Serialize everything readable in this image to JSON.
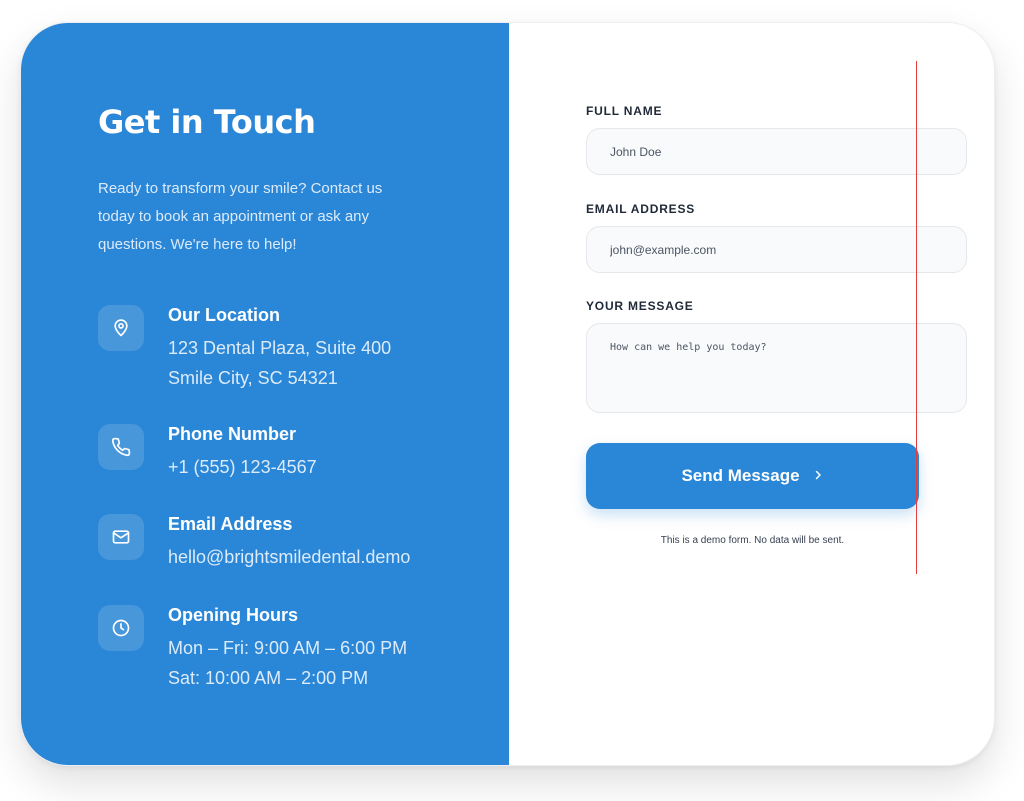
{
  "contact": {
    "title": "Get in Touch",
    "intro": "Ready to transform your smile? Contact us today to book an appointment or ask any questions. We're here to help!",
    "items": [
      {
        "icon": "map-pin-icon",
        "label": "Our Location",
        "lines": [
          "123 Dental Plaza, Suite 400",
          "Smile City, SC 54321"
        ]
      },
      {
        "icon": "phone-icon",
        "label": "Phone Number",
        "lines": [
          "+1 (555) 123-4567"
        ]
      },
      {
        "icon": "mail-icon",
        "label": "Email Address",
        "lines": [
          "hello@brightsmiledental.demo"
        ]
      },
      {
        "icon": "clock-icon",
        "label": "Opening Hours",
        "lines": [
          "Mon – Fri: 9:00 AM – 6:00 PM",
          "Sat: 10:00 AM – 2:00 PM"
        ]
      }
    ]
  },
  "form": {
    "name_label": "FULL NAME",
    "name_placeholder": "John Doe",
    "email_label": "EMAIL ADDRESS",
    "email_placeholder": "john@example.com",
    "message_label": "YOUR MESSAGE",
    "message_placeholder": "How can we help you today?",
    "submit_label": "Send Message",
    "note": "This is a demo form. No data will be sent."
  },
  "colors": {
    "primary": "#2a86d6",
    "panel_text_muted": "#dcebfa",
    "guide_line": "#e53e3e"
  }
}
